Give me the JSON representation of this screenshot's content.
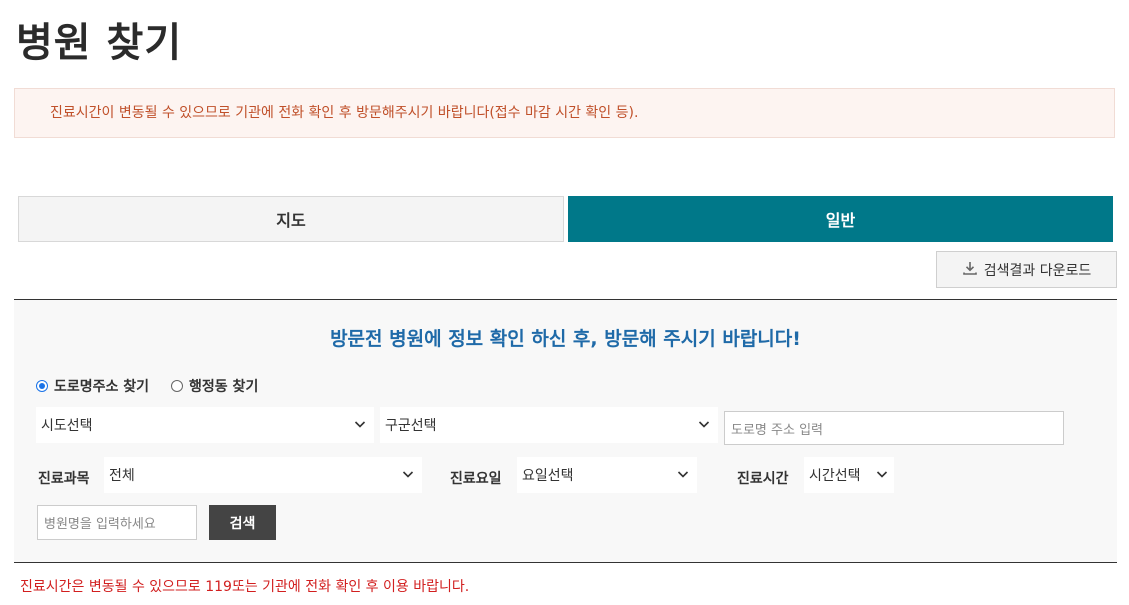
{
  "page": {
    "title": "병원 찾기"
  },
  "notice": {
    "text": "진료시간이 변동될 수 있으므로 기관에 전화 확인 후 방문해주시기 바랍니다(접수 마감 시간 확인 등)."
  },
  "tabs": [
    {
      "label": "지도",
      "active": false
    },
    {
      "label": "일반",
      "active": true
    }
  ],
  "download": {
    "label": "검색결과 다운로드",
    "icon": "download-icon"
  },
  "search": {
    "heading": "방문전 병원에 정보 확인 하신 후, 방문해 주시기 바랍니다!",
    "address_mode": {
      "options": [
        "도로명주소 찾기",
        "행정동 찾기"
      ],
      "selected": "도로명주소 찾기"
    },
    "sido_select": "시도선택",
    "gugun_select": "구군선택",
    "road_address_placeholder": "도로명 주소 입력",
    "department": {
      "label": "진료과목",
      "value": "전체"
    },
    "day": {
      "label": "진료요일",
      "value": "요일선택"
    },
    "time": {
      "label": "진료시간",
      "value": "시간선택"
    },
    "hospital_name_placeholder": "병원명을 입력하세요",
    "search_button": "검색"
  },
  "footer": {
    "note": "진료시간은 변동될 수 있으므로 119또는 기관에 전화 확인 후 이용 바랍니다."
  },
  "colors": {
    "accent": "#007889",
    "heading_blue": "#1f6aa8",
    "warning_red": "#d21f1f",
    "notice_text": "#c0502a"
  }
}
